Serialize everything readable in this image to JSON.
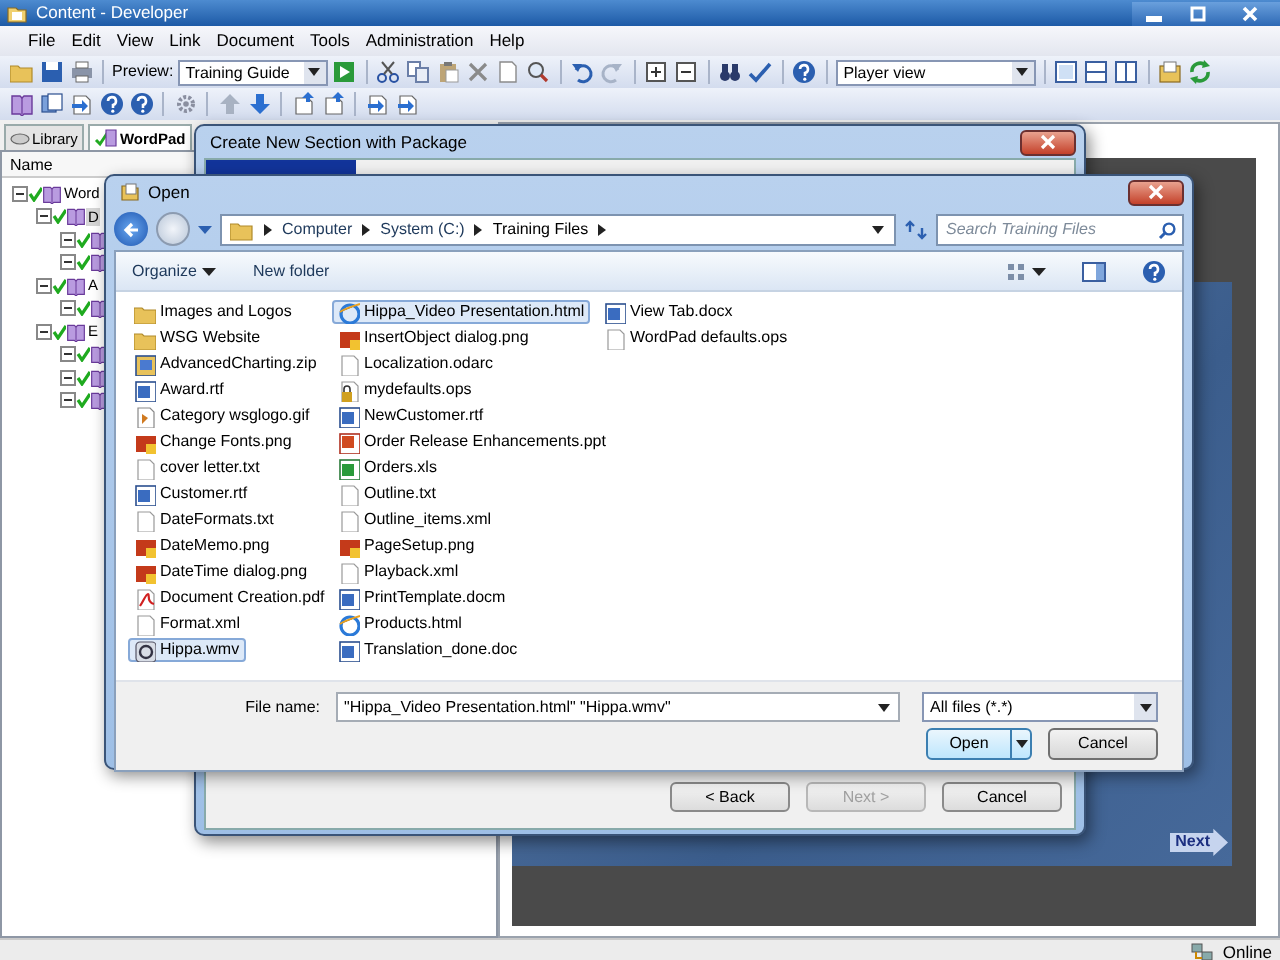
{
  "window": {
    "title": "Content - Developer"
  },
  "menu": [
    "File",
    "Edit",
    "View",
    "Link",
    "Document",
    "Tools",
    "Administration",
    "Help"
  ],
  "toolbar": {
    "preview_label": "Preview:",
    "preview_select": "Training Guide",
    "view_select": "Player view"
  },
  "tabs": [
    {
      "label": "Library",
      "selected": false
    },
    {
      "label": "WordPad",
      "selected": true
    }
  ],
  "tree": {
    "header": "Name",
    "items": [
      {
        "label": "Word",
        "checked": true,
        "expanded": true,
        "selected": false,
        "children": [
          {
            "label": "D",
            "checked": true,
            "expanded": true,
            "selected": true,
            "children": [
              {
                "checked": true,
                "expanded": true,
                "selected": false
              },
              {
                "checked": true,
                "expanded": true,
                "selected": false
              }
            ]
          },
          {
            "label": "A",
            "checked": true,
            "expanded": true,
            "selected": false,
            "children": [
              {
                "checked": true,
                "expanded": true,
                "selected": false
              }
            ]
          },
          {
            "label": "E",
            "checked": true,
            "expanded": true,
            "selected": false,
            "children": [
              {
                "checked": true,
                "expanded": true,
                "selected": false
              },
              {
                "checked": true,
                "expanded": true,
                "selected": false
              },
              {
                "checked": true,
                "expanded": true,
                "selected": false
              }
            ]
          }
        ]
      }
    ]
  },
  "slide": {
    "next_label": "Next"
  },
  "wizard": {
    "title": "Create New Section with Package",
    "buttons": [
      {
        "label": "< Back",
        "disabled": false
      },
      {
        "label": "Next >",
        "disabled": true
      },
      {
        "label": "Cancel",
        "disabled": false
      }
    ]
  },
  "open_dialog": {
    "title": "Open",
    "path": [
      "Computer",
      "System (C:)",
      "Training Files"
    ],
    "search": {
      "placeholder": "Search Training Files"
    },
    "commands": [
      {
        "label": "Organize",
        "kind": "menu"
      },
      {
        "label": "New folder",
        "kind": "plain"
      }
    ],
    "files": [
      {
        "name": "Images and Logos",
        "kind": "folder",
        "selected": false
      },
      {
        "name": "WSG Website",
        "kind": "folder",
        "selected": false
      },
      {
        "name": "AdvancedCharting.zip",
        "kind": "archive",
        "selected": false
      },
      {
        "name": "Award.rtf",
        "kind": "word",
        "selected": false
      },
      {
        "name": "Category wsglogo.gif",
        "kind": "picture",
        "selected": false
      },
      {
        "name": "Change Fonts.png",
        "kind": "image",
        "selected": false
      },
      {
        "name": "cover letter.txt",
        "kind": "text",
        "selected": false
      },
      {
        "name": "Customer.rtf",
        "kind": "word",
        "selected": false
      },
      {
        "name": "DateFormats.txt",
        "kind": "text",
        "selected": false
      },
      {
        "name": "DateMemo.png",
        "kind": "image",
        "selected": false
      },
      {
        "name": "DateTime dialog.png",
        "kind": "image",
        "selected": false
      },
      {
        "name": "Document Creation.pdf",
        "kind": "pdf",
        "selected": false
      },
      {
        "name": "Format.xml",
        "kind": "text",
        "selected": false
      },
      {
        "name": "Hippa.wmv",
        "kind": "video",
        "selected": true
      },
      {
        "name": "Hippa_Video Presentation.html",
        "kind": "web",
        "selected": true
      },
      {
        "name": "InsertObject dialog.png",
        "kind": "image",
        "selected": false
      },
      {
        "name": "Localization.odarc",
        "kind": "text",
        "selected": false
      },
      {
        "name": "mydefaults.ops",
        "kind": "locked",
        "selected": false
      },
      {
        "name": "NewCustomer.rtf",
        "kind": "word",
        "selected": false
      },
      {
        "name": "Order Release Enhancements.ppt",
        "kind": "slides",
        "selected": false
      },
      {
        "name": "Orders.xls",
        "kind": "sheet",
        "selected": false
      },
      {
        "name": "Outline.txt",
        "kind": "text",
        "selected": false
      },
      {
        "name": "Outline_items.xml",
        "kind": "text",
        "selected": false
      },
      {
        "name": "PageSetup.png",
        "kind": "image",
        "selected": false
      },
      {
        "name": "Playback.xml",
        "kind": "text",
        "selected": false
      },
      {
        "name": "PrintTemplate.docm",
        "kind": "word",
        "selected": false
      },
      {
        "name": "Products.html",
        "kind": "web",
        "selected": false
      },
      {
        "name": "Translation_done.doc",
        "kind": "word",
        "selected": false
      },
      {
        "name": "View Tab.docx",
        "kind": "word",
        "selected": false
      },
      {
        "name": "WordPad defaults.ops",
        "kind": "text",
        "selected": false
      }
    ],
    "file_name_label": "File name:",
    "file_name": "\"Hippa_Video Presentation.html\" \"Hippa.wmv\"",
    "filter": "All files (*.*)",
    "buttons": [
      {
        "label": "Open",
        "kind": "split"
      },
      {
        "label": "Cancel",
        "kind": "plain"
      }
    ]
  },
  "status_bar": {
    "text": "Online"
  }
}
